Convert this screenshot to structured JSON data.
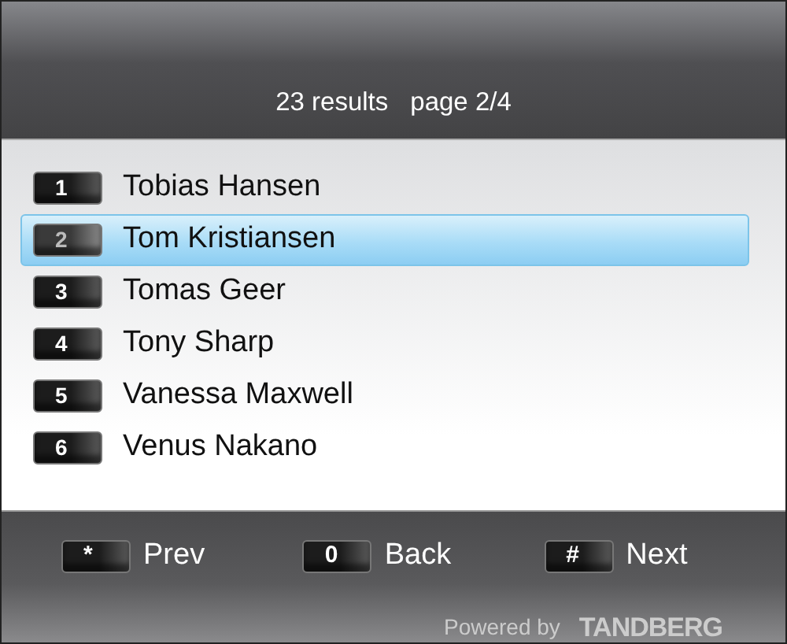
{
  "header": {
    "results": "23 results",
    "page": "page 2/4"
  },
  "results": [
    {
      "key": "1",
      "name": "Tobias Hansen",
      "selected": false
    },
    {
      "key": "2",
      "name": "Tom Kristiansen",
      "selected": true
    },
    {
      "key": "3",
      "name": "Tomas Geer",
      "selected": false
    },
    {
      "key": "4",
      "name": "Tony Sharp",
      "selected": false
    },
    {
      "key": "5",
      "name": "Vanessa Maxwell",
      "selected": false
    },
    {
      "key": "6",
      "name": "Venus Nakano",
      "selected": false
    }
  ],
  "footer": {
    "buttons": [
      {
        "key": "*",
        "label": "Prev"
      },
      {
        "key": "0",
        "label": "Back"
      },
      {
        "key": "#",
        "label": "Next"
      }
    ],
    "powered_by": "Powered by",
    "brand": "TANDBERG"
  }
}
